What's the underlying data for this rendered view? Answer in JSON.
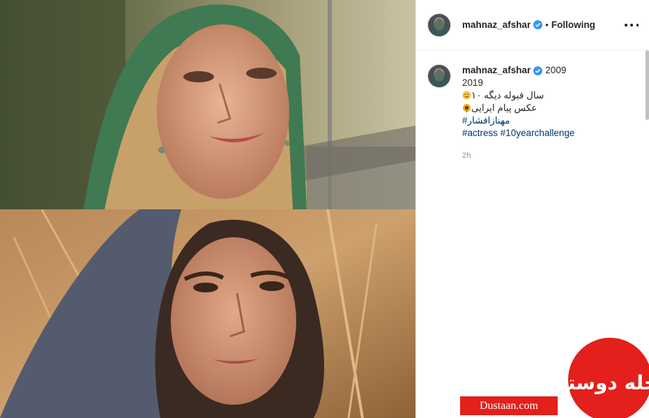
{
  "post": {
    "username": "mahnaz_afshar",
    "separator": "•",
    "follow_state": "Following",
    "more_label": "more-options"
  },
  "caption": {
    "username": "mahnaz_afshar",
    "line1_year": "2009",
    "line2": "2019",
    "line3": "سال قبوله دیگه ۱۰",
    "line4": "عکس پیام ایرایی",
    "hashtag1": "#مهنازافشار",
    "hashtag2": "#actress",
    "hashtag3": "#10yearchallenge",
    "timestamp": "2h"
  },
  "watermark": {
    "url": "Dustaan.com",
    "logo_text": "مجله دوستان"
  },
  "icons": {
    "verified": "verified-badge-icon",
    "more": "more-dots-icon",
    "emoji_wink": "winking-face-icon",
    "emoji_flower": "sunflower-icon"
  },
  "colors": {
    "hashtag": "#00376b",
    "verified": "#3897f0",
    "watermark_red": "#e3201b",
    "muted": "#8e8e8e"
  }
}
